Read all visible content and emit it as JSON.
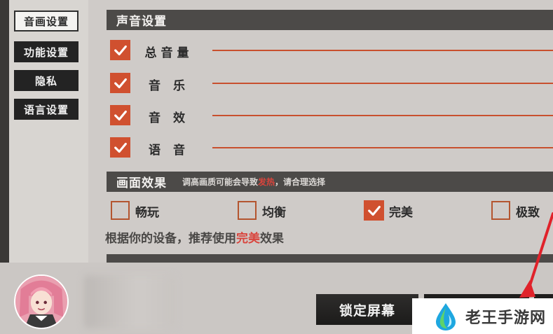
{
  "sidebar": {
    "items": [
      {
        "label": "音画设置",
        "active": true
      },
      {
        "label": "功能设置",
        "active": false
      },
      {
        "label": "隐私",
        "active": false
      },
      {
        "label": "语言设置",
        "active": false
      }
    ]
  },
  "sound": {
    "title": "声音设置",
    "items": [
      {
        "label": "总音量",
        "checked": true
      },
      {
        "label": "音 乐",
        "checked": true
      },
      {
        "label": "音 效",
        "checked": true
      },
      {
        "label": "语 音",
        "checked": true
      }
    ]
  },
  "graphics": {
    "title": "画面效果",
    "note_prefix": "调高画质可能会导致",
    "note_warn": "发热",
    "note_suffix": "，请合理选择",
    "options": [
      {
        "label": "畅玩",
        "checked": false
      },
      {
        "label": "均衡",
        "checked": false
      },
      {
        "label": "完美",
        "checked": true
      },
      {
        "label": "极致",
        "checked": false
      }
    ],
    "recommend_prefix": "根据你的设备，推荐使用",
    "recommend_highlight": "完美",
    "recommend_suffix": "效果"
  },
  "bottom": {
    "lock_label": "锁定屏幕"
  },
  "watermark": {
    "text": "老王手游网"
  },
  "colors": {
    "accent": "#d0502f",
    "header": "#4c4a48",
    "warn": "#d9443c",
    "annotation_arrow": "#e0222a"
  }
}
